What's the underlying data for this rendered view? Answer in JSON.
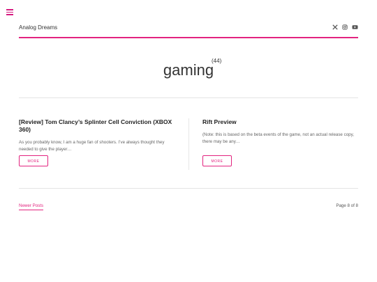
{
  "header": {
    "site_title": "Analog Dreams",
    "social_icons": [
      "x-icon",
      "instagram-icon",
      "youtube-icon"
    ]
  },
  "accent_color": "#e2237f",
  "tag": {
    "name": "gaming",
    "count": "(44)"
  },
  "posts": [
    {
      "title": "[Review] Tom Clancy’s Splinter Cell Conviction (XBOX 360)",
      "excerpt": "As you probably know, I am a huge fan of shooters. I’ve always thought they needed to give the player…",
      "more_label": "MORE"
    },
    {
      "title": "Rift Preview",
      "excerpt": "(Note: this is based on the beta events of the game, not an actual release copy, there may be any…",
      "more_label": "MORE"
    }
  ],
  "pagination": {
    "newer_label": "Newer Posts",
    "page_info": "Page 8 of 8"
  }
}
